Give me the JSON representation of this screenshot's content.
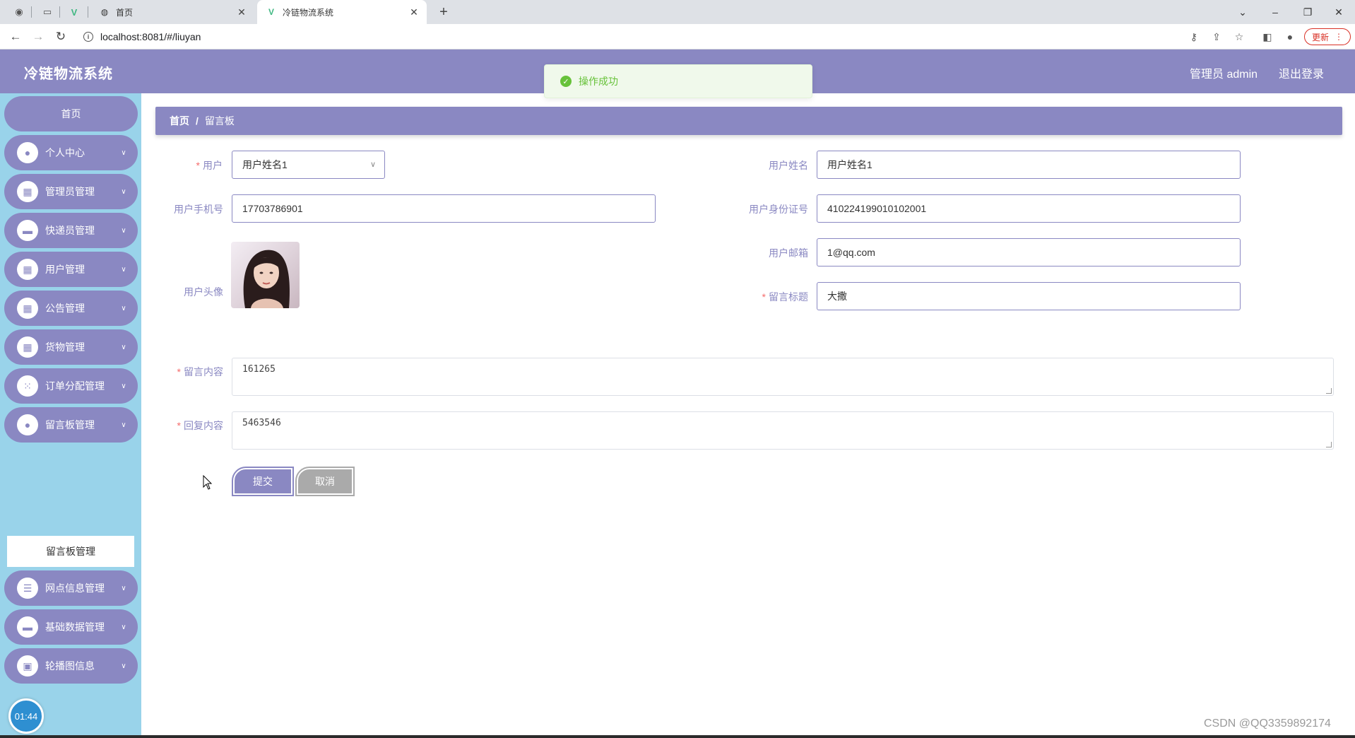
{
  "browser": {
    "tabs": [
      {
        "title": "首页",
        "active": false
      },
      {
        "title": "冷链物流系统",
        "active": true
      }
    ],
    "url": "localhost:8081/#/liuyan",
    "update_label": "更新"
  },
  "header": {
    "app_title": "冷链物流系统",
    "user_label": "管理员 admin",
    "logout_label": "退出登录"
  },
  "toast": {
    "message": "操作成功",
    "type": "success"
  },
  "sidebar": {
    "items": [
      {
        "label": "首页",
        "icon": "home"
      },
      {
        "label": "个人中心",
        "icon": "user-icon"
      },
      {
        "label": "管理员管理",
        "icon": "grid-icon"
      },
      {
        "label": "快递员管理",
        "icon": "monitor-icon"
      },
      {
        "label": "用户管理",
        "icon": "grid-icon"
      },
      {
        "label": "公告管理",
        "icon": "grid-icon"
      },
      {
        "label": "货物管理",
        "icon": "grid-icon"
      },
      {
        "label": "订单分配管理",
        "icon": "apps-icon"
      },
      {
        "label": "留言板管理",
        "icon": "user-icon"
      },
      {
        "label": "网点信息管理",
        "icon": "sliders-icon"
      },
      {
        "label": "基础数据管理",
        "icon": "monitor-icon"
      },
      {
        "label": "轮播图信息",
        "icon": "briefcase-icon"
      }
    ],
    "active_submenu": "留言板管理",
    "timer": "01:44"
  },
  "breadcrumb": {
    "home": "首页",
    "separator": "/",
    "current": "留言板"
  },
  "form": {
    "user_label": "用户",
    "user_value": "用户姓名1",
    "name_label": "用户姓名",
    "name_value": "用户姓名1",
    "phone_label": "用户手机号",
    "phone_value": "17703786901",
    "idcard_label": "用户身份证号",
    "idcard_value": "410224199010102001",
    "avatar_label": "用户头像",
    "email_label": "用户邮箱",
    "email_value": "1@qq.com",
    "title_label": "留言标题",
    "title_value": "大撒",
    "content_label": "留言内容",
    "content_value": "161265",
    "reply_label": "回复内容",
    "reply_value": "5463546",
    "submit_label": "提交",
    "cancel_label": "取消"
  },
  "watermark": "CSDN @QQ3359892174",
  "colors": {
    "primary": "#8a88c2",
    "sidebar_bg": "#99d3ea",
    "success": "#67c23a",
    "required": "#f56c6c"
  }
}
